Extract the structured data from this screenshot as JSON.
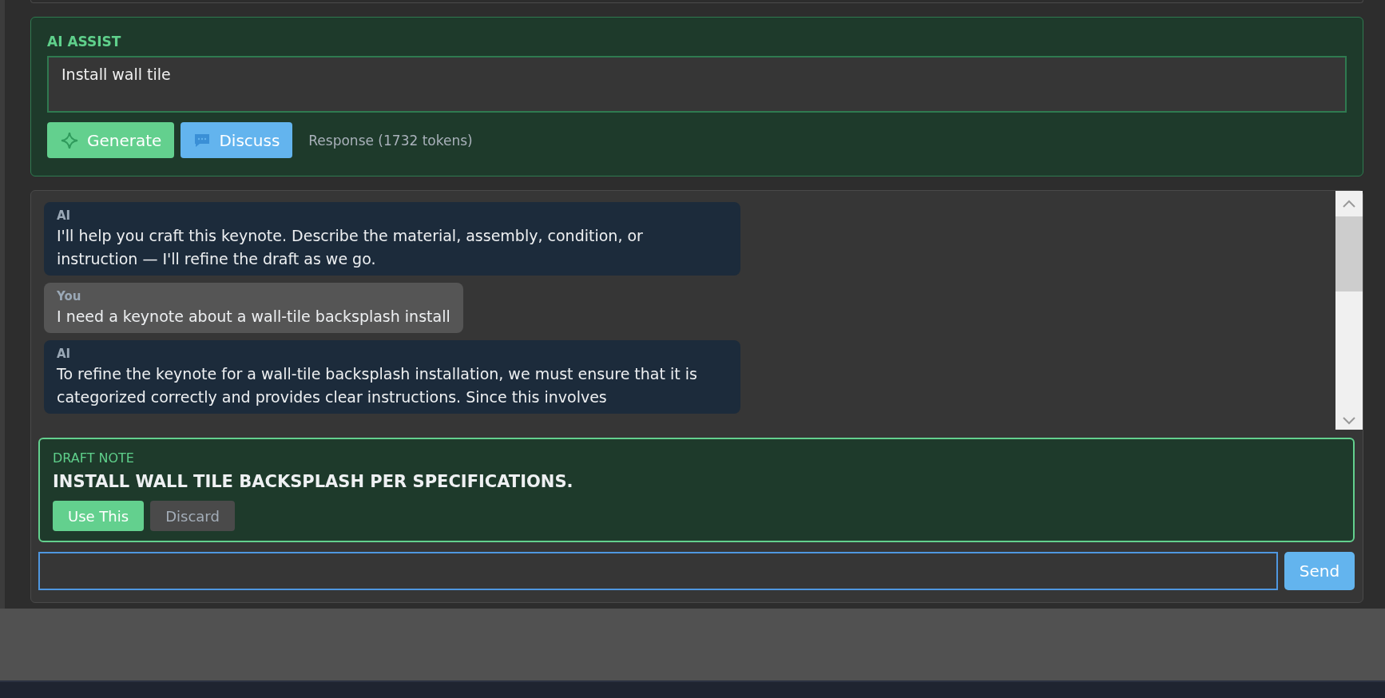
{
  "ai_assist": {
    "title": "AI ASSIST",
    "prompt": "Install wall tile",
    "buttons": [
      {
        "kind": "generate",
        "label": "Generate"
      },
      {
        "kind": "discuss",
        "label": "Discuss"
      }
    ],
    "status": "Response (1732 tokens)"
  },
  "chat": {
    "messages": [
      {
        "kind": "ai",
        "role": "AI",
        "text": "I'll help you craft this keynote. Describe the material, assembly, condition, or instruction — I'll refine the draft as we go."
      },
      {
        "kind": "user",
        "role": "You",
        "text": "I need a keynote about a wall-tile backsplash install"
      },
      {
        "kind": "ai",
        "role": "AI",
        "text": "To refine the keynote for a wall-tile backsplash installation, we must ensure that it is categorized correctly and provides clear instructions. Since this involves"
      }
    ],
    "draft": {
      "title": "DRAFT NOTE",
      "text": "INSTALL WALL TILE BACKSPLASH PER SPECIFICATIONS.",
      "buttons": [
        {
          "kind": "primary",
          "label": "Use This"
        },
        {
          "kind": "secondary",
          "label": "Discard"
        }
      ]
    },
    "send": "Send"
  }
}
